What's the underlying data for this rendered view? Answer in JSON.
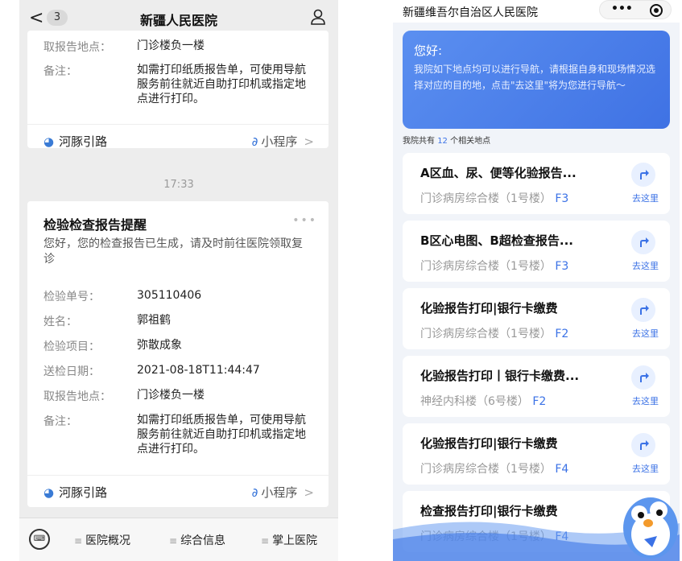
{
  "left": {
    "badge": "3",
    "title": "新疆人民医院",
    "card1": {
      "rows": [
        {
          "label": "取报告地点：",
          "value": "门诊楼负一楼"
        },
        {
          "label": "备注：",
          "value": "如需打印纸质报告单，可使用导航服务前往就近自助打印机或指定地点进行打印。"
        }
      ],
      "brand": "河豚引路",
      "mini": "小程序"
    },
    "time": "17:33",
    "card2": {
      "title": "检验检查报告提醒",
      "desc": "您好，您的检查报告已生成，请及时前往医院领取复诊",
      "rows": [
        {
          "label": "检验单号：",
          "value": "305110406"
        },
        {
          "label": "姓名：",
          "value": "郭祖鹤"
        },
        {
          "label": "检验项目：",
          "value": "弥散成象"
        },
        {
          "label": "送检日期：",
          "value": "2021-08-18T11:44:47"
        },
        {
          "label": "取报告地点：",
          "value": "门诊楼负一楼"
        },
        {
          "label": "备注：",
          "value": "如需打印纸质报告单，可使用导航服务前往就近自助打印机或指定地点进行打印。"
        }
      ],
      "brand": "河豚引路",
      "mini": "小程序"
    },
    "menus": [
      "医院概况",
      "综合信息",
      "掌上医院"
    ]
  },
  "right": {
    "title": "新疆维吾尔自治区人民医院",
    "greet_title": "您好:",
    "greet_text": "我院如下地点均可以进行导航，请根据自身和现场情况选择对应的目的地，点击\"去这里\"将为您进行导航～",
    "count_prefix": "我院共有 ",
    "count_num": "12",
    "count_suffix": " 个相关地点",
    "go_label": "去这里",
    "locations": [
      {
        "name": "A区血、尿、便等化验报告...",
        "building": "门诊病房综合楼（1号楼）",
        "floor": "F3"
      },
      {
        "name": "B区心电图、B超检查报告...",
        "building": "门诊病房综合楼（1号楼）",
        "floor": "F3"
      },
      {
        "name": "化验报告打印|银行卡缴费",
        "building": "门诊病房综合楼（1号楼）",
        "floor": "F2"
      },
      {
        "name": "化验报告打印丨银行卡缴费...",
        "building": "神经内科楼（6号楼）",
        "floor": "F2"
      },
      {
        "name": "化验报告打印|银行卡缴费",
        "building": "门诊病房综合楼（1号楼）",
        "floor": "F4"
      },
      {
        "name": "检查报告打印|银行卡缴费",
        "building": "门诊病房综合楼（1号楼）",
        "floor": "F4"
      }
    ]
  }
}
